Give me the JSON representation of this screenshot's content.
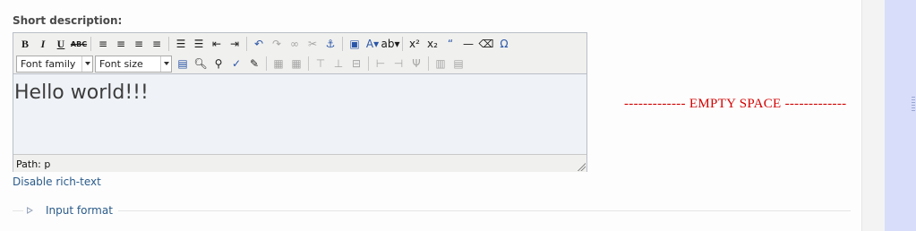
{
  "field": {
    "label": "Short description:"
  },
  "toolbar": {
    "row1": [
      {
        "name": "bold-button",
        "glyph": "B",
        "style": "bold serif"
      },
      {
        "name": "italic-button",
        "glyph": "I",
        "style": "italic serif"
      },
      {
        "name": "underline-button",
        "glyph": "U",
        "style": "underline serif"
      },
      {
        "name": "strikethrough-button",
        "glyph": "ABC",
        "style": "strike small"
      },
      {
        "name": "align-left-icon",
        "glyph": "≡"
      },
      {
        "name": "align-center-icon",
        "glyph": "≡"
      },
      {
        "name": "align-right-icon",
        "glyph": "≡"
      },
      {
        "name": "align-justify-icon",
        "glyph": "≡"
      },
      {
        "name": "bullet-list-icon",
        "glyph": "☰"
      },
      {
        "name": "numbered-list-icon",
        "glyph": "☰"
      },
      {
        "name": "outdent-icon",
        "glyph": "⇤"
      },
      {
        "name": "indent-icon",
        "glyph": "⇥"
      },
      {
        "name": "undo-icon",
        "glyph": "↶",
        "style": "blue"
      },
      {
        "name": "redo-icon",
        "glyph": "↷",
        "style": "dis"
      },
      {
        "name": "link-icon",
        "glyph": "∞",
        "style": "dis"
      },
      {
        "name": "unlink-icon",
        "glyph": "✂",
        "style": "dis"
      },
      {
        "name": "anchor-icon",
        "glyph": "⚓",
        "style": "blue"
      },
      {
        "name": "image-icon",
        "glyph": "▣",
        "style": "blue"
      },
      {
        "name": "text-color-icon",
        "glyph": "A▾",
        "style": "blue"
      },
      {
        "name": "highlight-color-icon",
        "glyph": "ab▾"
      },
      {
        "name": "superscript-icon",
        "glyph": "x²"
      },
      {
        "name": "subscript-icon",
        "glyph": "x₂"
      },
      {
        "name": "blockquote-icon",
        "glyph": "“",
        "style": "blue"
      },
      {
        "name": "horizontal-rule-icon",
        "glyph": "—"
      },
      {
        "name": "remove-format-icon",
        "glyph": "⌫"
      },
      {
        "name": "special-char-icon",
        "glyph": "Ω",
        "style": "blue"
      }
    ],
    "font_family": "Font family",
    "font_size": "Font size",
    "row2": [
      {
        "name": "paste-word-icon",
        "glyph": "▤",
        "style": "blue"
      },
      {
        "name": "find-icon",
        "glyph": "🔍︎"
      },
      {
        "name": "find-replace-icon",
        "glyph": "⚲"
      },
      {
        "name": "spellcheck-icon",
        "glyph": "✓",
        "style": "blue"
      },
      {
        "name": "edit-css-icon",
        "glyph": "✎"
      },
      {
        "name": "table-row-props-icon",
        "glyph": "▦",
        "style": "dis"
      },
      {
        "name": "table-cell-props-icon",
        "glyph": "▦",
        "style": "dis"
      },
      {
        "name": "insert-row-before-icon",
        "glyph": "⊤",
        "style": "dis"
      },
      {
        "name": "insert-row-after-icon",
        "glyph": "⊥",
        "style": "dis"
      },
      {
        "name": "delete-row-icon",
        "glyph": "⊟",
        "style": "dis"
      },
      {
        "name": "insert-col-before-icon",
        "glyph": "⊢",
        "style": "dis"
      },
      {
        "name": "insert-col-after-icon",
        "glyph": "⊣",
        "style": "dis"
      },
      {
        "name": "delete-col-icon",
        "glyph": "Ψ",
        "style": "dis"
      },
      {
        "name": "split-cells-icon",
        "glyph": "▥",
        "style": "dis"
      },
      {
        "name": "merge-cells-icon",
        "glyph": "▤",
        "style": "dis"
      }
    ]
  },
  "editor": {
    "content": "Hello world!!!",
    "status_path": "Path: p"
  },
  "links": {
    "disable_rich_text": "Disable rich-text"
  },
  "annotation": {
    "empty_space": "------------- EMPTY SPACE -------------"
  },
  "fieldset": {
    "legend": "Input format"
  }
}
